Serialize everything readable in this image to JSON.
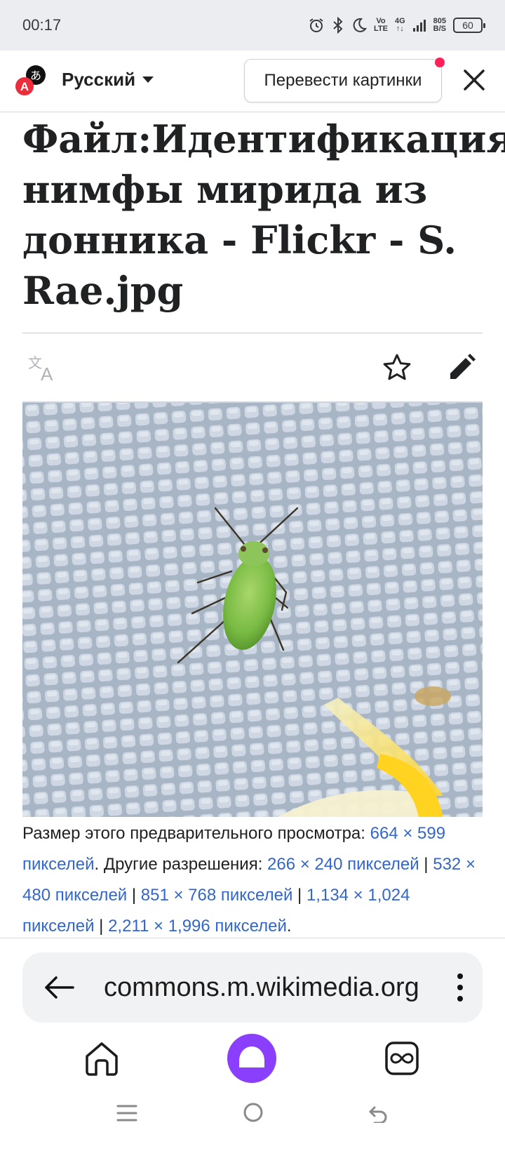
{
  "status_bar": {
    "time": "00:17",
    "network_top": "Vo",
    "network_bottom": "LTE",
    "gen": "4G",
    "speed_top": "805",
    "speed_bottom": "B/S",
    "battery": "60"
  },
  "translator": {
    "language": "Русский",
    "translate_images_button": "Перевести картинки",
    "logo_letter": "A",
    "logo_glyph": "あ"
  },
  "page": {
    "title": "Файл:Идентификация нимфы мирида из донника - Flickr - S. Rae.jpg",
    "image_alt": "Green mirid nymph on white mesh fabric",
    "info": {
      "preview_label": "Размер этого предварительного просмотра: ",
      "preview_size": "664 × 599 пикселей",
      "other_label": ". Другие разрешения: ",
      "sep": " | ",
      "end": ".",
      "resolutions": [
        "266 × 240 пикселей",
        "532 × 480 пикселей",
        "851 × 768 пикселей",
        "1,134 × 1,024 пикселей",
        "2,211 × 1,996 пикселей"
      ]
    }
  },
  "browser": {
    "url": "commons.m.wikimedia.org"
  },
  "icons": {
    "accent": "#8a3ffc",
    "link": "#3366cc",
    "badge": "#ff1f5a"
  }
}
